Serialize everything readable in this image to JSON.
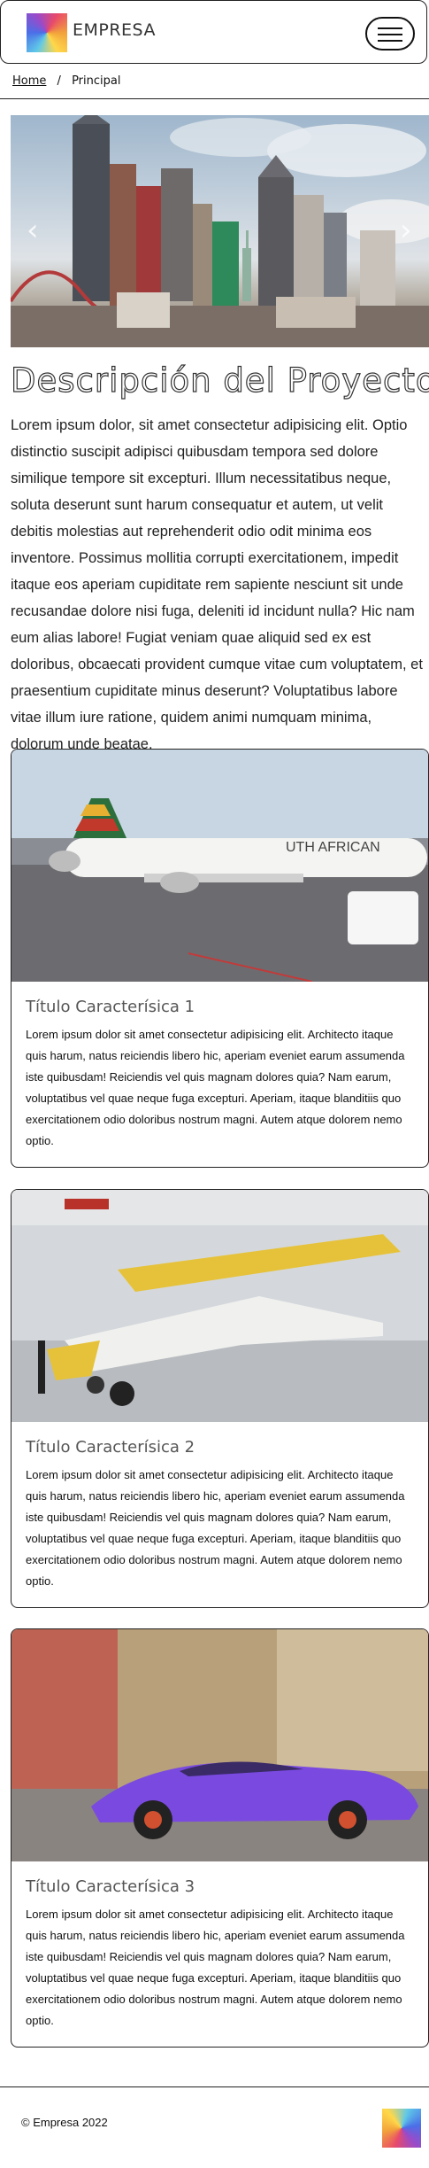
{
  "navbar": {
    "brand": "EMPRESA",
    "logo_icon": "colorful-abstract-logo",
    "toggle_icon": "hamburger-menu-icon"
  },
  "breadcrumb": {
    "home": "Home",
    "separator": "/",
    "current": "Principal"
  },
  "carousel": {
    "slide_image": "city-skyline-las-vegas",
    "prev_icon": "chevron-left-icon",
    "next_icon": "chevron-right-icon",
    "prev_glyph": "‹",
    "next_glyph": "›"
  },
  "project": {
    "title": "Descripción del Proyecto",
    "description": "Lorem ipsum dolor, sit amet consectetur adipisicing elit. Optio distinctio suscipit adipisci quibusdam tempora sed dolore similique tempore sit excepturi. Illum necessitatibus neque, soluta deserunt sunt harum consequatur et autem, ut velit debitis molestias aut reprehenderit odio odit minima eos inventore. Possimus mollitia corrupti exercitationem, impedit itaque eos aperiam cupiditate rem sapiente nesciunt sit unde recusandae dolore nisi fuga, deleniti id incidunt nulla? Hic nam eum alias labore! Fugiat veniam quae aliquid sed ex est doloribus, obcaecati provident cumque vitae cum voluptatem, et praesentium cupiditate minus deserunt? Voluptatibus labore vitae illum iure ratione, quidem animi numquam minima, dolorum unde beatae."
  },
  "features": [
    {
      "image": "south-african-airliner",
      "image_text": "UTH AFRICAN",
      "title": "Título Caracterísica 1",
      "text": "Lorem ipsum dolor sit amet consectetur adipisicing elit. Architecto itaque quis harum, natus reiciendis libero hic, aperiam eveniet earum assumenda iste quibusdam! Reiciendis vel quis magnam dolores quia? Nam earum, voluptatibus vel quae neque fuga excepturi. Aperiam, itaque blanditiis quo exercitationem odio doloribus nostrum magni. Autem atque dolorem nemo optio."
    },
    {
      "image": "yellow-propeller-plane",
      "title": "Título Caracterísica 2",
      "text": "Lorem ipsum dolor sit amet consectetur adipisicing elit. Architecto itaque quis harum, natus reiciendis libero hic, aperiam eveniet earum assumenda iste quibusdam! Reiciendis vel quis magnam dolores quia? Nam earum, voluptatibus vel quae neque fuga excepturi. Aperiam, itaque blanditiis quo exercitationem odio doloribus nostrum magni. Autem atque dolorem nemo optio."
    },
    {
      "image": "purple-sports-car",
      "title": "Título Caracterísica 3",
      "text": "Lorem ipsum dolor sit amet consectetur adipisicing elit. Architecto itaque quis harum, natus reiciendis libero hic, aperiam eveniet earum assumenda iste quibusdam! Reiciendis vel quis magnam dolores quia? Nam earum, voluptatibus vel quae neque fuga excepturi. Aperiam, itaque blanditiis quo exercitationem odio doloribus nostrum magni. Autem atque dolorem nemo optio."
    }
  ],
  "footer": {
    "copyright": "© Empresa 2022",
    "logo_icon": "colorful-abstract-logo"
  }
}
